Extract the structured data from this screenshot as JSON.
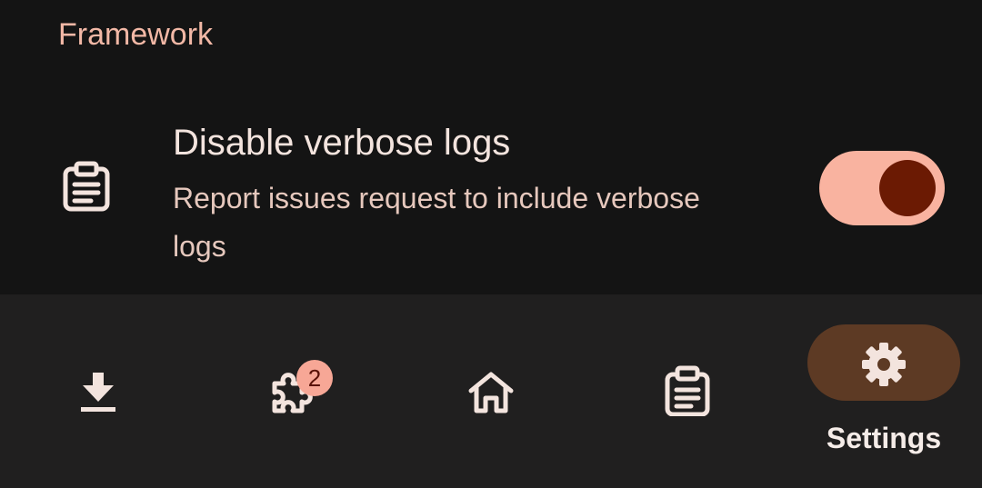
{
  "section": {
    "header": "Framework"
  },
  "setting": {
    "icon": "clipboard-list-icon",
    "title": "Disable verbose logs",
    "subtitle": "Report issues request to include verbose logs",
    "toggle_on": true
  },
  "nav": {
    "items": [
      {
        "icon": "download-icon",
        "label": ""
      },
      {
        "icon": "puzzle-icon",
        "label": "",
        "badge": "2"
      },
      {
        "icon": "home-icon",
        "label": ""
      },
      {
        "icon": "clipboard-list-icon",
        "label": ""
      },
      {
        "icon": "gear-icon",
        "label": "Settings",
        "selected": true
      }
    ]
  },
  "colors": {
    "background": "#141414",
    "nav_background": "#201f1f",
    "accent": "#f9b3a0",
    "toggle_knob": "#6b1a03",
    "selected_pill": "#5d3a24"
  }
}
